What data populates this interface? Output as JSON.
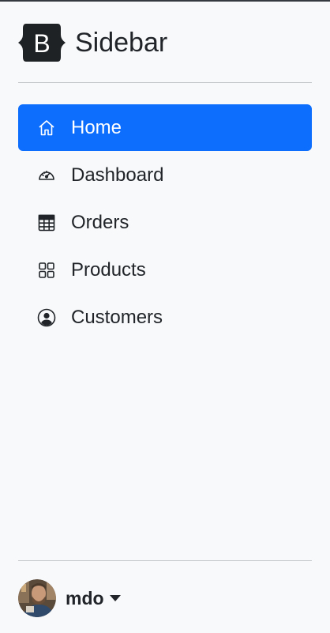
{
  "brand": {
    "logo_letter": "B",
    "title": "Sidebar"
  },
  "nav": {
    "items": [
      {
        "label": "Home",
        "icon": "home-icon",
        "active": true
      },
      {
        "label": "Dashboard",
        "icon": "speedometer-icon",
        "active": false
      },
      {
        "label": "Orders",
        "icon": "table-icon",
        "active": false
      },
      {
        "label": "Products",
        "icon": "grid-icon",
        "active": false
      },
      {
        "label": "Customers",
        "icon": "person-circle-icon",
        "active": false
      }
    ]
  },
  "user": {
    "name": "mdo",
    "avatar_icon": "avatar-photo"
  },
  "colors": {
    "active_bg": "#0d6efd",
    "sidebar_bg": "#f8f9fa",
    "text": "#212529"
  }
}
